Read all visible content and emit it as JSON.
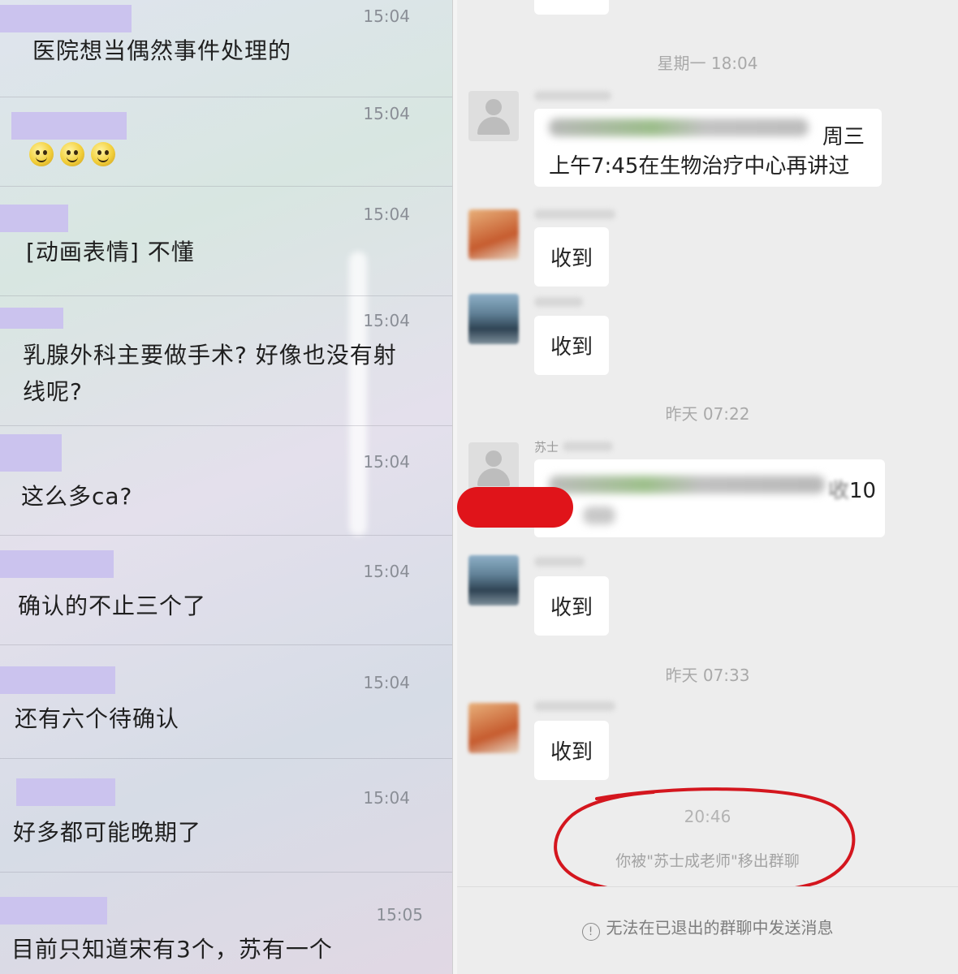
{
  "left_chat": {
    "messages": [
      {
        "time": "15:04",
        "text": "医院想当偶然事件处理的"
      },
      {
        "time": "15:04",
        "text": ""
      },
      {
        "time": "15:04",
        "text": "[动画表情] 不懂"
      },
      {
        "time": "15:04",
        "text": "乳腺外科主要做手术? 好像也没有射线呢?"
      },
      {
        "time": "15:04",
        "text": "这么多ca?"
      },
      {
        "time": "15:04",
        "text": "确认的不止三个了"
      },
      {
        "time": "15:04",
        "text": "还有六个待确认"
      },
      {
        "time": "15:04",
        "text": "好多都可能晚期了"
      },
      {
        "time": "15:05",
        "text": "目前只知道宋有3个，苏有一个"
      }
    ]
  },
  "right_chat": {
    "timestamps": [
      "星期一 18:04",
      "昨天 07:22",
      "昨天 07:33",
      "20:46"
    ],
    "msg1": {
      "tail_top": "周三",
      "line2": "上午7:45在生物治疗中心再讲过"
    },
    "received": "收到",
    "sender_partial": "苏士",
    "msg_partial_end": "10",
    "removed_notice": "你被\"苏士成老师\"移出群聊",
    "footer_notice": "无法在已退出的群聊中发送消息",
    "highlight_color": "#d4161e"
  }
}
